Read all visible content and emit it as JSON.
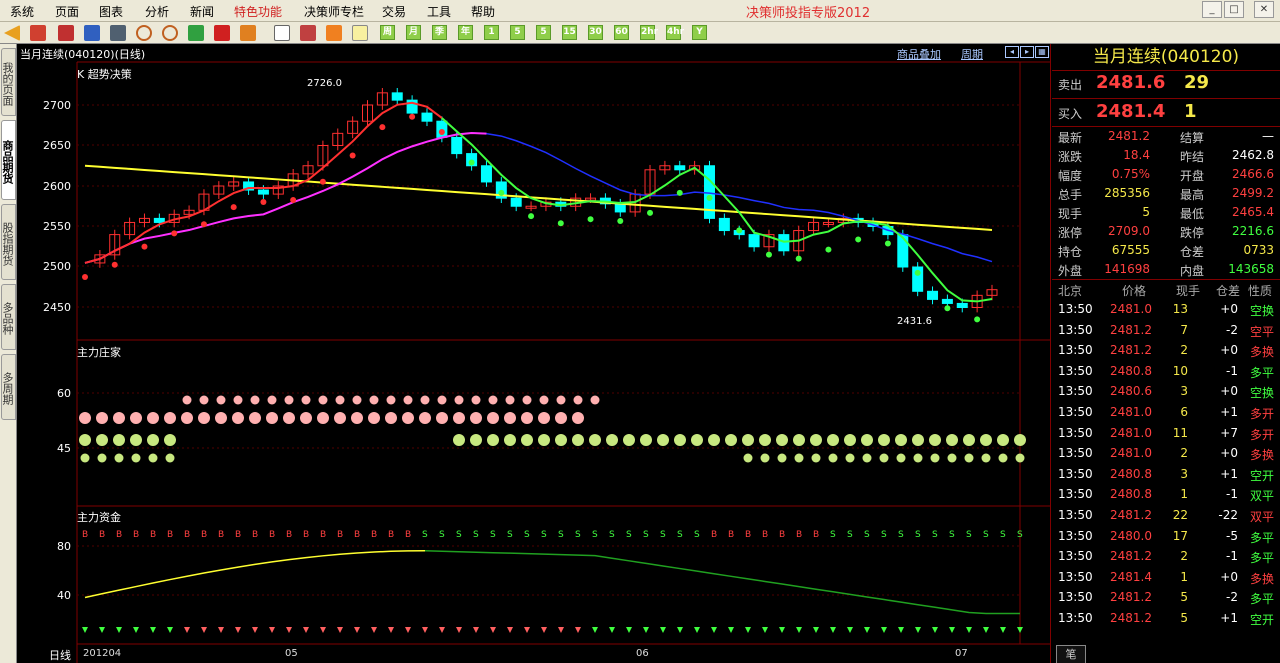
{
  "menu": {
    "items": [
      "系统",
      "页面",
      "图表",
      "分析",
      "新闻",
      "特色功能",
      "决策师专栏",
      "交易",
      "工具",
      "帮助"
    ],
    "app_title": "决策师投指专版2012"
  },
  "toolbar": {
    "period_buttons": [
      "周",
      "月",
      "季",
      "年",
      "1",
      "5",
      "5",
      "15",
      "30",
      "60",
      "2hr",
      "4hr",
      "Y"
    ]
  },
  "left_tabs": [
    "我的页面",
    "商品期货",
    "股指期货",
    "多品种",
    "多周期"
  ],
  "chart": {
    "header": "当月连续(040120)(日线)",
    "links": [
      "商品叠加",
      "周期"
    ],
    "panel1_label": "K  超势决策",
    "panel2_label": "主力庄家",
    "panel3_label": "主力资金",
    "y_axis_top": [
      "2700",
      "2650",
      "2600",
      "2550",
      "2500",
      "2450"
    ],
    "y_axis_mid": [
      "60",
      "45"
    ],
    "y_axis_bot": [
      "80",
      "40"
    ],
    "max_label": "2726.0",
    "min_label": "2431.6",
    "x_period": "日线",
    "x_labels": [
      "201204",
      "05",
      "06",
      "07"
    ],
    "colors": {
      "up": "#ff3030",
      "down": "#00ffff",
      "ma_yellow": "#ffff30",
      "ma_blue": "#2030ff",
      "ma_magenta": "#ff30ff",
      "ma_green": "#40ff40",
      "grid": "#800000"
    }
  },
  "quote": {
    "title": "当月连续(040120)",
    "ask": {
      "label": "卖出",
      "price": "2481.6",
      "vol": "29"
    },
    "bid": {
      "label": "买入",
      "price": "2481.4",
      "vol": "1"
    },
    "stats": [
      {
        "l1": "最新",
        "v1": "2481.2",
        "c1": "#ff4040",
        "l2": "结算",
        "v2": "—",
        "c2": "#ffffff"
      },
      {
        "l1": "涨跌",
        "v1": "18.4",
        "c1": "#ff4040",
        "l2": "昨结",
        "v2": "2462.8",
        "c2": "#ffffff"
      },
      {
        "l1": "幅度",
        "v1": "0.75%",
        "c1": "#ff4040",
        "l2": "开盘",
        "v2": "2466.6",
        "c2": "#ff4040"
      },
      {
        "l1": "总手",
        "v1": "285356",
        "c1": "#f5e84a",
        "l2": "最高",
        "v2": "2499.2",
        "c2": "#ff4040"
      },
      {
        "l1": "现手",
        "v1": "5",
        "c1": "#f5e84a",
        "l2": "最低",
        "v2": "2465.4",
        "c2": "#ff4040"
      },
      {
        "l1": "涨停",
        "v1": "2709.0",
        "c1": "#ff4040",
        "l2": "跌停",
        "v2": "2216.6",
        "c2": "#40ff40"
      },
      {
        "l1": "持仓",
        "v1": "67555",
        "c1": "#f5e84a",
        "l2": "仓差",
        "v2": "0733",
        "c2": "#f5e84a"
      },
      {
        "l1": "外盘",
        "v1": "141698",
        "c1": "#ff4040",
        "l2": "内盘",
        "v2": "143658",
        "c2": "#40ff40"
      }
    ],
    "trade_headers": [
      "北京",
      "价格",
      "现手",
      "仓差",
      "性质"
    ],
    "trades": [
      {
        "t": "13:50",
        "p": "2481.0",
        "v": "13",
        "d": "+0",
        "n": "空换",
        "nc": "#40ff40"
      },
      {
        "t": "13:50",
        "p": "2481.2",
        "v": "7",
        "d": "-2",
        "n": "空平",
        "nc": "#ff4040"
      },
      {
        "t": "13:50",
        "p": "2481.2",
        "v": "2",
        "d": "+0",
        "n": "多换",
        "nc": "#ff4040"
      },
      {
        "t": "13:50",
        "p": "2480.8",
        "v": "10",
        "d": "-1",
        "n": "多平",
        "nc": "#40ff40"
      },
      {
        "t": "13:50",
        "p": "2480.6",
        "v": "3",
        "d": "+0",
        "n": "空换",
        "nc": "#40ff40"
      },
      {
        "t": "13:50",
        "p": "2481.0",
        "v": "6",
        "d": "+1",
        "n": "多开",
        "nc": "#ff4040"
      },
      {
        "t": "13:50",
        "p": "2481.0",
        "v": "11",
        "d": "+7",
        "n": "多开",
        "nc": "#ff4040"
      },
      {
        "t": "13:50",
        "p": "2481.0",
        "v": "2",
        "d": "+0",
        "n": "多换",
        "nc": "#ff4040"
      },
      {
        "t": "13:50",
        "p": "2480.8",
        "v": "3",
        "d": "+1",
        "n": "空开",
        "nc": "#40ff40"
      },
      {
        "t": "13:50",
        "p": "2480.8",
        "v": "1",
        "d": "-1",
        "n": "双平",
        "nc": "#40ff40"
      },
      {
        "t": "13:50",
        "p": "2481.2",
        "v": "22",
        "d": "-22",
        "n": "双平",
        "nc": "#ff4040"
      },
      {
        "t": "13:50",
        "p": "2480.0",
        "v": "17",
        "d": "-5",
        "n": "多平",
        "nc": "#40ff40"
      },
      {
        "t": "13:50",
        "p": "2481.2",
        "v": "2",
        "d": "-1",
        "n": "多平",
        "nc": "#40ff40"
      },
      {
        "t": "13:50",
        "p": "2481.4",
        "v": "1",
        "d": "+0",
        "n": "多换",
        "nc": "#ff4040"
      },
      {
        "t": "13:50",
        "p": "2481.2",
        "v": "5",
        "d": "-2",
        "n": "多平",
        "nc": "#40ff40"
      },
      {
        "t": "13:50",
        "p": "2481.2",
        "v": "5",
        "d": "+1",
        "n": "空开",
        "nc": "#40ff40"
      }
    ],
    "bottom_tab": "笔"
  }
}
